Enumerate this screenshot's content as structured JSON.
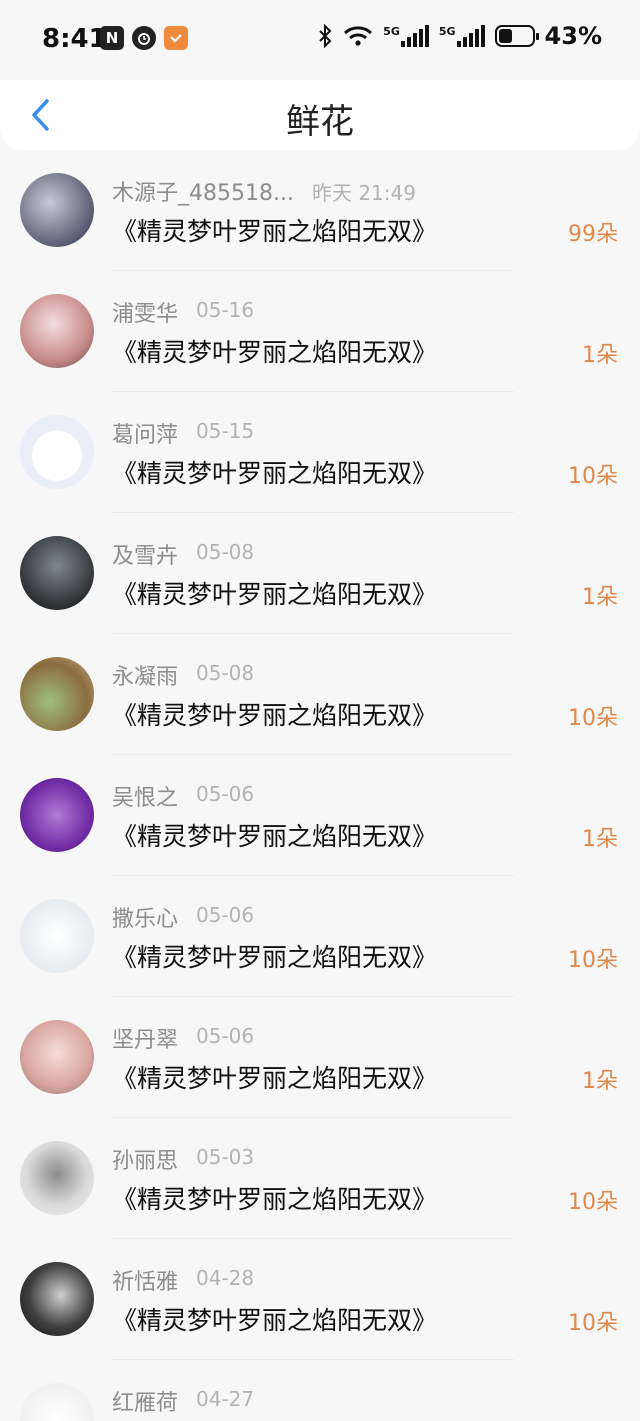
{
  "status_bar": {
    "time": "8:41",
    "battery_percent": "43%",
    "battery_level": 0.43,
    "network_labels": [
      "5G",
      "5G"
    ],
    "icons": [
      "nfc-icon",
      "alarm-icon",
      "app-badge-icon",
      "bluetooth-icon",
      "wifi-icon",
      "signal-icon",
      "signal-icon",
      "battery-icon"
    ]
  },
  "header": {
    "title": "鲜花",
    "back_icon": "chevron-left-icon"
  },
  "colors": {
    "accent": "#3a8ef6",
    "amount": "#e0884a"
  },
  "items": [
    {
      "name": "木源子_485518...",
      "date": "昨天 21:49",
      "book": "《精灵梦叶罗丽之焰阳无双》",
      "amount": "99朵"
    },
    {
      "name": "浦雯华",
      "date": "05-16",
      "book": "《精灵梦叶罗丽之焰阳无双》",
      "amount": "1朵"
    },
    {
      "name": "葛问萍",
      "date": "05-15",
      "book": "《精灵梦叶罗丽之焰阳无双》",
      "amount": "10朵"
    },
    {
      "name": "及雪卉",
      "date": "05-08",
      "book": "《精灵梦叶罗丽之焰阳无双》",
      "amount": "1朵"
    },
    {
      "name": "永凝雨",
      "date": "05-08",
      "book": "《精灵梦叶罗丽之焰阳无双》",
      "amount": "10朵"
    },
    {
      "name": "吴恨之",
      "date": "05-06",
      "book": "《精灵梦叶罗丽之焰阳无双》",
      "amount": "1朵"
    },
    {
      "name": "撒乐心",
      "date": "05-06",
      "book": "《精灵梦叶罗丽之焰阳无双》",
      "amount": "10朵"
    },
    {
      "name": "坚丹翠",
      "date": "05-06",
      "book": "《精灵梦叶罗丽之焰阳无双》",
      "amount": "1朵"
    },
    {
      "name": "孙丽思",
      "date": "05-03",
      "book": "《精灵梦叶罗丽之焰阳无双》",
      "amount": "10朵"
    },
    {
      "name": "祈恬雅",
      "date": "04-28",
      "book": "《精灵梦叶罗丽之焰阳无双》",
      "amount": "10朵"
    },
    {
      "name": "红雁荷",
      "date": "04-27",
      "book": "",
      "amount": ""
    }
  ]
}
